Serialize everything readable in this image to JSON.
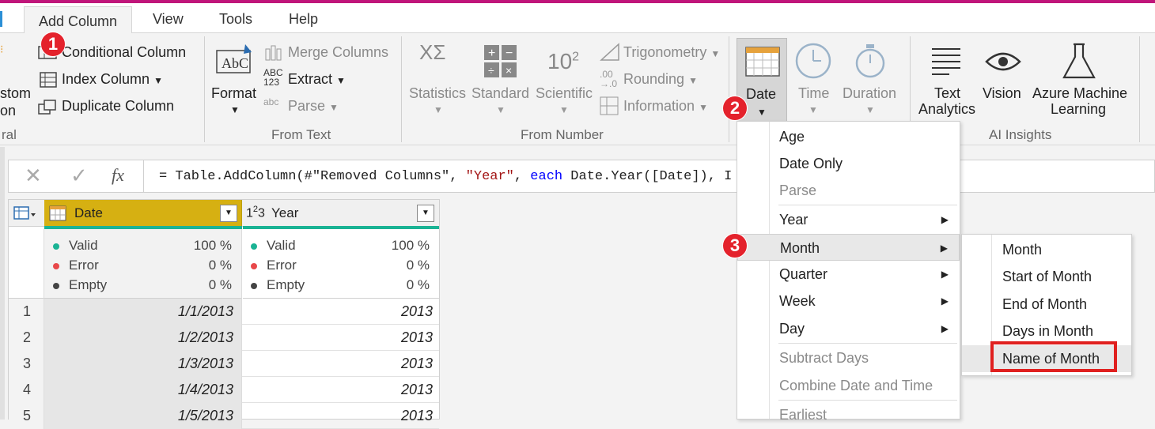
{
  "tabs": {
    "add_column": "Add Column",
    "view": "View",
    "tools": "Tools",
    "help": "Help"
  },
  "ribbon": {
    "general": {
      "custom_label_1": "stom",
      "custom_label_2": "on",
      "group_label": "ral",
      "conditional_column": "Conditional Column",
      "index_column": "Index Column",
      "duplicate_column": "Duplicate Column"
    },
    "from_text": {
      "format": "Format",
      "merge_columns": "Merge Columns",
      "extract": "Extract",
      "parse": "Parse",
      "group_label": "From Text"
    },
    "from_number": {
      "statistics": "Statistics",
      "standard": "Standard",
      "scientific": "Scientific",
      "trigonometry": "Trigonometry",
      "rounding": "Rounding",
      "information": "Information",
      "group_label": "From Number"
    },
    "date_time": {
      "date": "Date",
      "time": "Time",
      "duration": "Duration"
    },
    "ai_insights": {
      "text_analytics_1": "Text",
      "text_analytics_2": "Analytics",
      "vision": "Vision",
      "azure_ml_1": "Azure Machine",
      "azure_ml_2": "Learning",
      "group_label": "AI Insights"
    }
  },
  "formula_bar": {
    "fx": "fx",
    "p1": "= Table.AddColumn(#\"Removed Columns\", ",
    "p2": "\"Year\"",
    "p3": ", ",
    "p4": "each",
    "p5": " Date.Year([Date]), I"
  },
  "grid": {
    "columns": [
      {
        "name": "Date",
        "type_icon": "calendar-icon"
      },
      {
        "name": "Year",
        "type_icon": "123"
      }
    ],
    "quality": {
      "date": [
        {
          "label": "Valid",
          "value": "100 %"
        },
        {
          "label": "Error",
          "value": "0 %"
        },
        {
          "label": "Empty",
          "value": "0 %"
        }
      ],
      "year": [
        {
          "label": "Valid",
          "value": "100 %"
        },
        {
          "label": "Error",
          "value": "0 %"
        },
        {
          "label": "Empty",
          "value": "0 %"
        }
      ]
    },
    "rows": [
      {
        "n": "1",
        "date": "1/1/2013",
        "year": "2013"
      },
      {
        "n": "2",
        "date": "1/2/2013",
        "year": "2013"
      },
      {
        "n": "3",
        "date": "1/3/2013",
        "year": "2013"
      },
      {
        "n": "4",
        "date": "1/4/2013",
        "year": "2013"
      },
      {
        "n": "5",
        "date": "1/5/2013",
        "year": "2013"
      }
    ]
  },
  "date_menu": {
    "items": [
      "Age",
      "Date Only",
      "Parse",
      "Year",
      "Month",
      "Quarter",
      "Week",
      "Day",
      "Subtract Days",
      "Combine Date and Time",
      "Earliest"
    ]
  },
  "month_submenu": {
    "items": [
      "Month",
      "Start of Month",
      "End of Month",
      "Days in Month",
      "Name of Month"
    ]
  },
  "badges": [
    "1",
    "2",
    "3"
  ],
  "colors": {
    "accent_bar": "#c0157a",
    "badge": "#e4222c",
    "highlight_box": "#e0201f",
    "date_header": "#d6b012",
    "quality_bar": "#1ab394",
    "valid": "#1ab394",
    "error": "#e8484a",
    "empty": "#444444"
  }
}
